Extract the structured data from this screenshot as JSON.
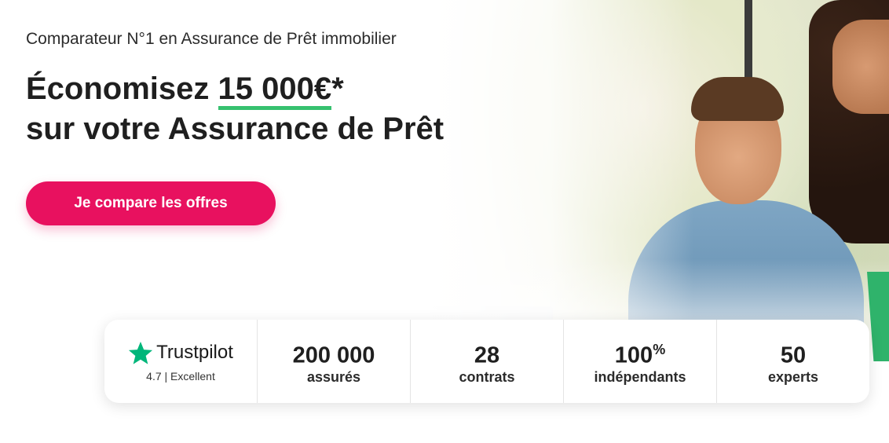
{
  "hero": {
    "subtitle": "Comparateur N°1 en Assurance de Prêt immobilier",
    "headline_prefix": "Économisez ",
    "headline_amount": "15 000€",
    "headline_asterisk": "*",
    "headline_line2": "sur votre Assurance de Prêt",
    "cta_label": "Je compare les offres"
  },
  "stats": {
    "trustpilot": {
      "name": "Trustpilot",
      "rating": "4.7 | Excellent",
      "star_color": "#00b67a"
    },
    "items": [
      {
        "value": "200 000",
        "sup": "",
        "label": "assurés"
      },
      {
        "value": "28",
        "sup": "",
        "label": "contrats"
      },
      {
        "value": "100",
        "sup": "%",
        "label": "indépendants"
      },
      {
        "value": "50",
        "sup": "",
        "label": "experts"
      }
    ]
  },
  "colors": {
    "cta": "#e8115f",
    "underline": "#36c16f"
  }
}
